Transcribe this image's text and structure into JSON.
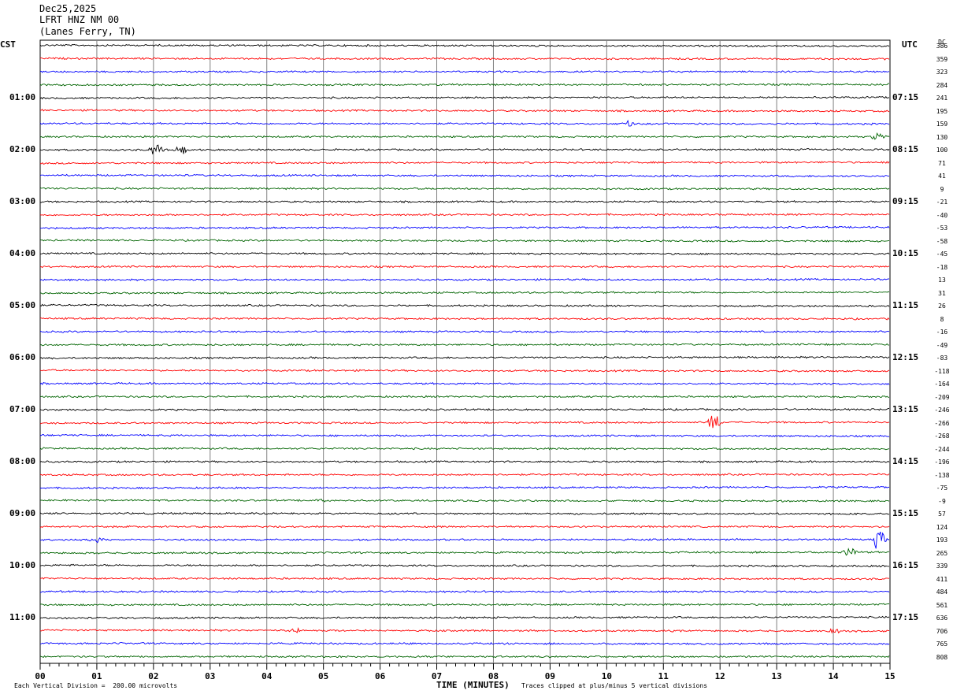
{
  "header": {
    "date": "Dec25,2025",
    "station": "LFRT HNZ NM 00",
    "location": "(Lanes Ferry, TN)"
  },
  "left_tz": "CST",
  "right_tz": "UTC",
  "dc_header": "DC",
  "footer": {
    "vertical_division": "Each Vertical Division =  200.00 microvolts",
    "xlabel": "TIME (MINUTES)",
    "clip_note": "Traces clipped at plus/minus 5 vertical divisions"
  },
  "colors": {
    "trace_cycle": [
      "#000000",
      "#ff0000",
      "#0000ff",
      "#006400"
    ],
    "grid": "#808080"
  },
  "chart_data": {
    "type": "line",
    "title": "LFRT HNZ NM 00",
    "xlabel": "TIME (MINUTES)",
    "x_ticks": [
      "00",
      "01",
      "02",
      "03",
      "04",
      "05",
      "06",
      "07",
      "08",
      "09",
      "10",
      "11",
      "12",
      "13",
      "14",
      "15"
    ],
    "xlim": [
      0,
      15
    ],
    "left_hour_labels": [
      "01:00",
      "02:00",
      "03:00",
      "04:00",
      "05:00",
      "06:00",
      "07:00",
      "08:00",
      "09:00",
      "10:00",
      "11:00"
    ],
    "right_hour_labels": [
      "07:15",
      "08:15",
      "09:15",
      "10:15",
      "11:15",
      "12:15",
      "13:15",
      "14:15",
      "15:15",
      "16:15",
      "17:15"
    ],
    "dc_offsets": [
      386,
      359,
      323,
      284,
      241,
      195,
      159,
      130,
      100,
      71,
      41,
      9,
      -21,
      -40,
      -53,
      -58,
      -45,
      -18,
      13,
      31,
      26,
      8,
      -16,
      -49,
      -83,
      -118,
      -164,
      -209,
      -246,
      -266,
      -268,
      -244,
      -196,
      -138,
      -75,
      -9,
      57,
      124,
      193,
      265,
      339,
      411,
      484,
      561,
      636,
      706,
      765,
      808
    ],
    "trace_count": 48,
    "events": [
      {
        "trace": 8,
        "minute": 2.05,
        "amplitude": 1.0
      },
      {
        "trace": 8,
        "minute": 2.5,
        "amplitude": 0.7
      },
      {
        "trace": 6,
        "minute": 10.4,
        "amplitude": 0.4
      },
      {
        "trace": 7,
        "minute": 14.8,
        "amplitude": 0.9
      },
      {
        "trace": 29,
        "minute": 11.9,
        "amplitude": 1.5
      },
      {
        "trace": 38,
        "minute": 1.0,
        "amplitude": 0.5
      },
      {
        "trace": 38,
        "minute": 14.8,
        "amplitude": 1.6
      },
      {
        "trace": 39,
        "minute": 14.3,
        "amplitude": 0.7
      },
      {
        "trace": 35,
        "minute": 5.0,
        "amplitude": 0.35
      },
      {
        "trace": 45,
        "minute": 4.5,
        "amplitude": 0.4
      },
      {
        "trace": 45,
        "minute": 14.0,
        "amplitude": 0.4
      }
    ]
  }
}
